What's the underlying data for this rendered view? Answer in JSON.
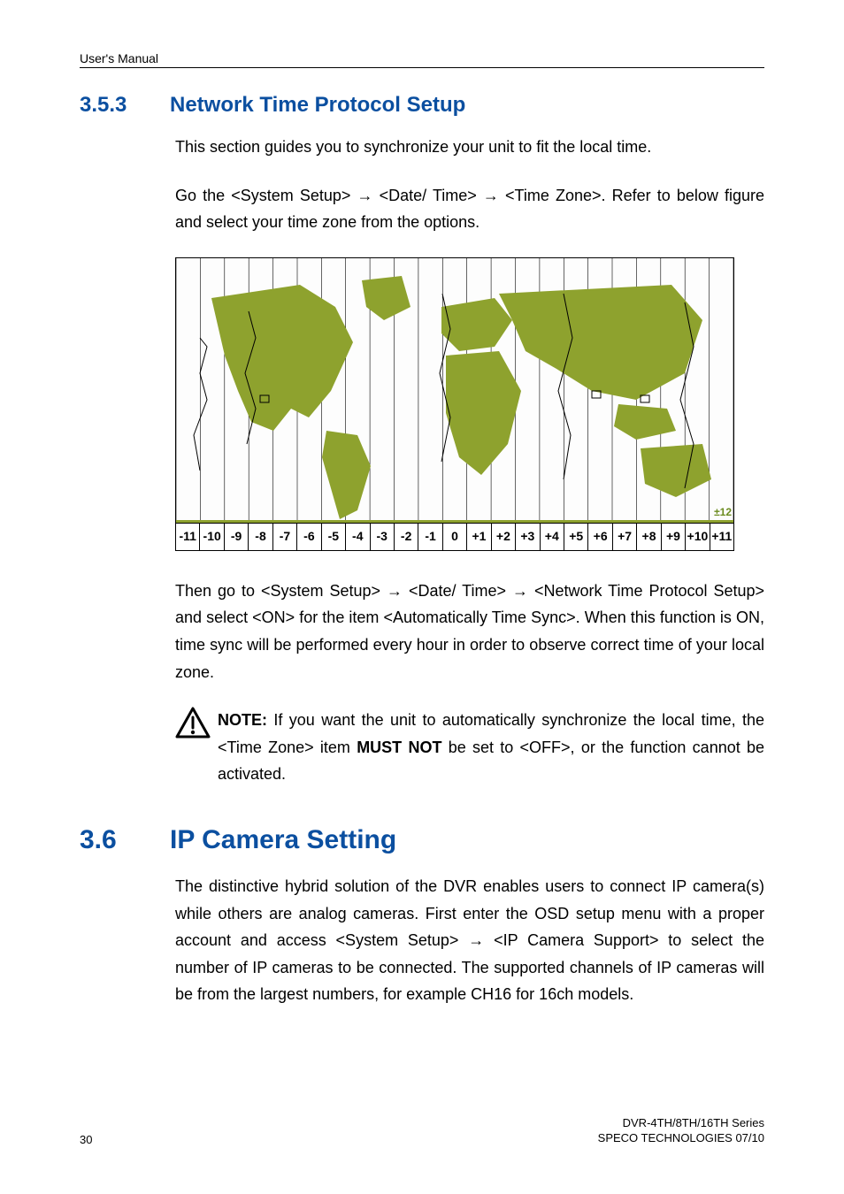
{
  "running_head": "User's Manual",
  "sections": {
    "s353": {
      "num": "3.5.3",
      "title": "Network Time Protocol Setup",
      "p1": "This section guides you to synchronize your unit to fit the local time.",
      "p2_a": "Go the <System Setup> ",
      "p2_b": " <Date/ Time> ",
      "p2_c": " <Time Zone>. Refer to below figure and select your time zone from the options.",
      "p3_a": "Then go to <System Setup> ",
      "p3_b": " <Date/ Time> ",
      "p3_c": " <Network Time Protocol Setup> and select <ON> for the item <Automatically Time Sync>. When this function is ON, time sync will be performed every hour in order to observe correct time of your local zone.",
      "note_label": "NOTE:",
      "note_a": " If you want the unit to automatically synchronize the local time, the <Time Zone> item ",
      "note_must": "MUST NOT",
      "note_b": " be set to <OFF>, or the function cannot be activated."
    },
    "s36": {
      "num": "3.6",
      "title": "IP Camera Setting",
      "p1_a": "The distinctive hybrid solution of the DVR enables users to connect IP camera(s) while others are analog cameras. First enter the OSD setup menu with a proper account and access <System Setup> ",
      "p1_b": " <IP Camera Support> to select the number of IP cameras to be connected. The supported channels of IP cameras will be from the largest numbers, for example CH16 for 16ch models."
    }
  },
  "arrow": "→",
  "chart_data": {
    "type": "table",
    "description": "World time-zone map strip showing UTC offsets",
    "offsets": [
      "-11",
      "-10",
      "-9",
      "-8",
      "-7",
      "-6",
      "-5",
      "-4",
      "-3",
      "-2",
      "-1",
      "0",
      "+1",
      "+2",
      "+3",
      "+4",
      "+5",
      "+6",
      "+7",
      "+8",
      "+9",
      "+10",
      "+11"
    ],
    "corner_tag": "±12"
  },
  "footer": {
    "page": "30",
    "line1": "DVR-4TH/8TH/16TH Series",
    "line2": "SPECO TECHNOLOGIES 07/10"
  }
}
